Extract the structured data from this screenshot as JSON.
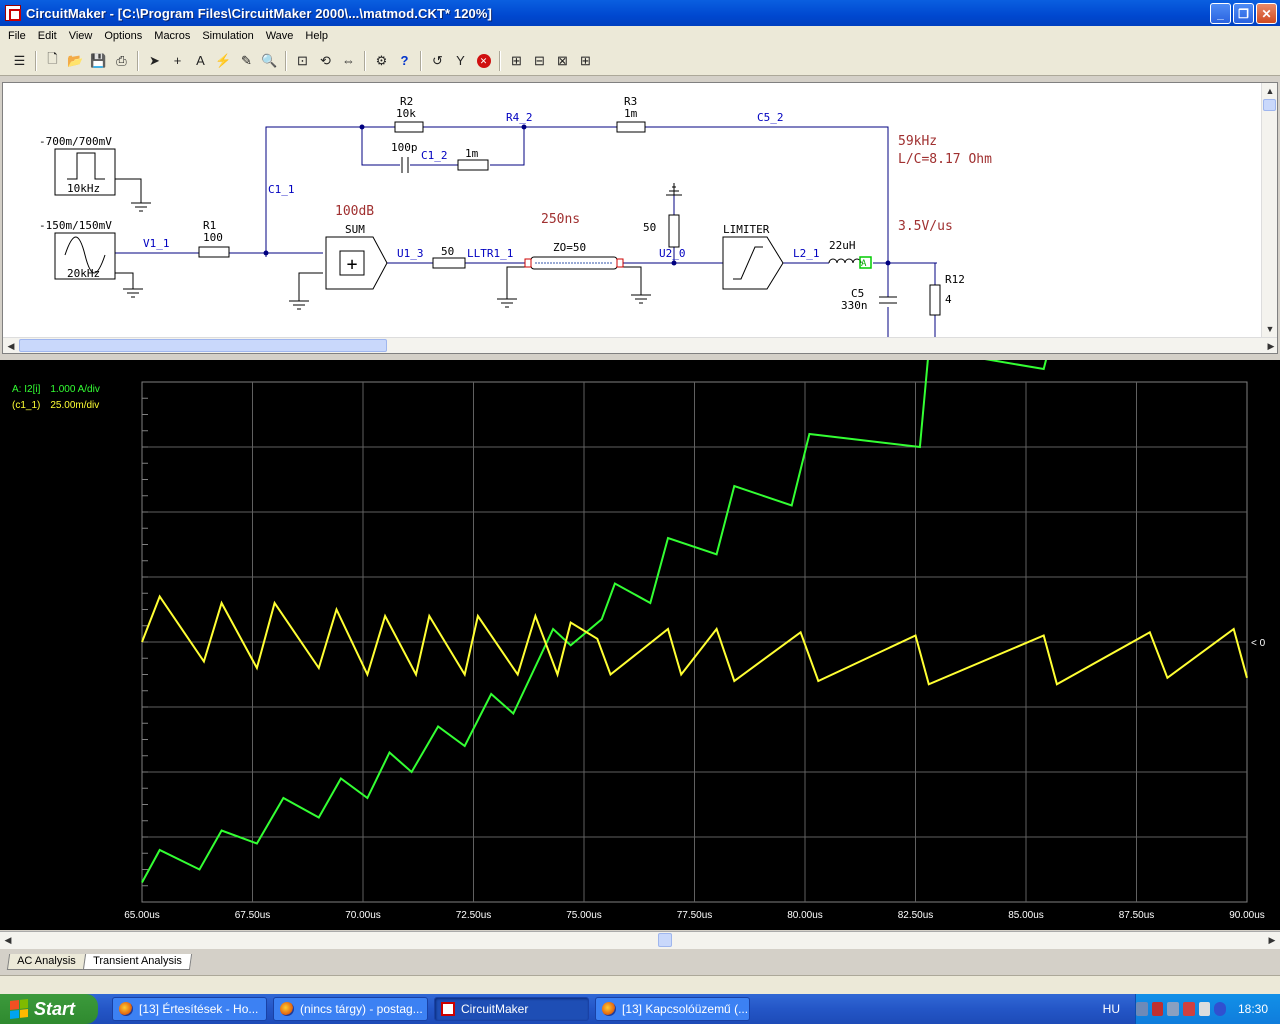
{
  "window": {
    "title": "CircuitMaker - [C:\\Program Files\\CircuitMaker 2000\\...\\matmod.CKT* 120%]",
    "min": "_",
    "max": "❐",
    "close": "✕"
  },
  "menu": [
    "File",
    "Edit",
    "View",
    "Options",
    "Macros",
    "Simulation",
    "Wave",
    "Help"
  ],
  "toolbar_icons": [
    "hierarchy-icon",
    "new-icon",
    "open-icon",
    "save-icon",
    "print-icon",
    "arrow-tool-icon",
    "wire-tool-icon",
    "text-tool-icon",
    "probe-tool-icon",
    "pan-tool-icon",
    "zoom-icon",
    "zoom-fit-icon",
    "rotate-icon",
    "mirror-icon",
    "simulate-icon",
    "help-icon",
    "undo-icon",
    "reset-icon",
    "stop-icon",
    "run-icon",
    "step-icon",
    "trace-icon",
    "scope-icon"
  ],
  "schematic": {
    "src1": {
      "range": "-700m/700mV",
      "freq": "10kHz"
    },
    "src2": {
      "range": "-150m/150mV",
      "freq": "20kHz"
    },
    "net_v1": "V1_1",
    "r1": {
      "name": "R1",
      "val": "100"
    },
    "r2": {
      "name": "R2",
      "val": "10k"
    },
    "r3": {
      "name": "R3",
      "val": "1m"
    },
    "c1_cap": "100p",
    "c1_res": "1m",
    "net_c1_2": "C1_2",
    "net_r4_2": "R4_2",
    "net_c5_2": "C5_2",
    "net_c1_1": "C1_1",
    "gain": "100dB",
    "sum": "SUM",
    "net_u1_3": "U1_3",
    "r_50a": "50",
    "net_lltr": "LLTR1_1",
    "delay": "250ns",
    "zo": "ZO=50",
    "r_50b": "50",
    "net_u2_0": "U2_0",
    "limiter": "LIMITER",
    "net_l2_1": "L2_1",
    "ind": "22uH",
    "probe": "A",
    "freq_note": "59kHz",
    "lc_note": "L/C=8.17 Ohm",
    "slew_note": "3.5V/us",
    "c5": {
      "name": "C5",
      "val": "330n"
    },
    "r12": {
      "name": "R12",
      "val": "4"
    }
  },
  "waveform": {
    "legend": [
      {
        "name": "A: I2[i]",
        "scale": "1.000 A/div",
        "color": "#33ff33"
      },
      {
        "name": "(c1_1)",
        "scale": "25.00m/div",
        "color": "#ffff33"
      }
    ],
    "zero_marker": "< 0",
    "x_ticks": [
      "65.00us",
      "67.50us",
      "70.00us",
      "72.50us",
      "75.00us",
      "77.50us",
      "80.00us",
      "82.50us",
      "85.00us",
      "87.50us",
      "90.00us"
    ]
  },
  "chart_data": {
    "type": "line",
    "xlabel": "",
    "ylabel": "",
    "xlim": [
      65,
      90
    ],
    "grid": true,
    "series": [
      {
        "name": "A: I2[i]",
        "color": "#33ff33",
        "x": [
          65.0,
          65.4,
          66.3,
          66.8,
          67.6,
          68.2,
          69.0,
          69.5,
          70.1,
          70.6,
          71.1,
          71.7,
          72.3,
          72.9,
          73.4,
          74.3,
          74.7,
          75.4,
          75.7,
          76.5,
          76.9,
          78.0,
          78.4,
          79.7,
          80.1,
          82.6,
          82.8,
          85.4,
          85.7,
          87.8,
          88.1,
          89.7,
          90.0
        ],
        "values": [
          -3.7,
          -3.2,
          -3.5,
          -2.9,
          -3.1,
          -2.4,
          -2.7,
          -2.1,
          -2.4,
          -1.7,
          -2.0,
          -1.3,
          -1.6,
          -0.8,
          -1.1,
          0.2,
          -0.05,
          0.35,
          0.9,
          0.6,
          1.6,
          1.35,
          2.4,
          2.1,
          3.2,
          3.0,
          4.5,
          4.2,
          5.0,
          4.7,
          5.3,
          5.0,
          5.5
        ]
      },
      {
        "name": "(c1_1)",
        "color": "#ffff33",
        "x": [
          65.0,
          65.4,
          66.4,
          66.8,
          67.6,
          68.0,
          69.0,
          69.4,
          70.1,
          70.5,
          71.2,
          71.5,
          72.3,
          72.6,
          73.5,
          73.9,
          74.4,
          74.7,
          75.3,
          75.6,
          76.9,
          77.2,
          78.0,
          78.4,
          79.9,
          80.3,
          82.5,
          82.8,
          85.4,
          85.7,
          87.8,
          88.2,
          89.7,
          90.0
        ],
        "values": [
          0.0,
          0.7,
          -0.3,
          0.6,
          -0.4,
          0.6,
          -0.4,
          0.5,
          -0.5,
          0.4,
          -0.5,
          0.4,
          -0.5,
          0.4,
          -0.5,
          0.4,
          -0.5,
          0.3,
          0.05,
          -0.5,
          0.2,
          -0.5,
          0.2,
          -0.6,
          0.15,
          -0.6,
          0.1,
          -0.65,
          0.1,
          -0.65,
          0.15,
          -0.55,
          0.2,
          -0.55
        ]
      }
    ]
  },
  "tabs": [
    "AC Analysis",
    "Transient Analysis"
  ],
  "taskbar": {
    "start": "Start",
    "tasks": [
      "[13] Értesítések - Ho...",
      "(nincs tárgy) - postag...",
      "CircuitMaker",
      "[13] Kapcsolóüzemű (..."
    ],
    "lang": "HU",
    "clock": "18:30"
  }
}
